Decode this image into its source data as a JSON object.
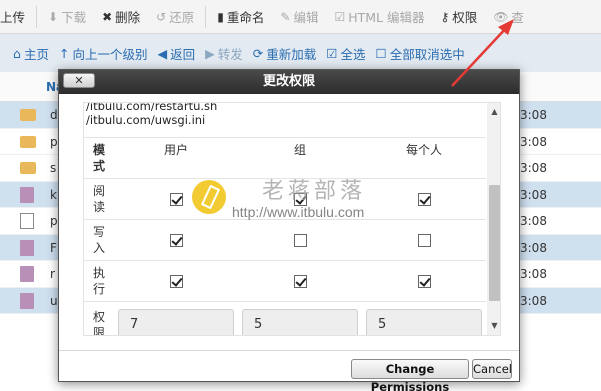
{
  "toolbar": {
    "items": [
      {
        "label": "上传",
        "icon": "upload-icon",
        "disabled": false
      },
      {
        "label": "下载",
        "icon": "download-icon",
        "disabled": true
      },
      {
        "label": "删除",
        "icon": "close-icon",
        "disabled": false
      },
      {
        "label": "还原",
        "icon": "undo-icon",
        "disabled": true
      },
      {
        "label": "重命名",
        "icon": "file-icon",
        "disabled": false
      },
      {
        "label": "编辑",
        "icon": "pencil-icon",
        "disabled": true
      },
      {
        "label": "HTML 编辑器",
        "icon": "html-editor-icon",
        "disabled": true
      },
      {
        "label": "权限",
        "icon": "key-icon",
        "disabled": false
      },
      {
        "label": "查",
        "icon": "eye-icon",
        "disabled": true
      }
    ]
  },
  "navbar": {
    "items": [
      {
        "label": "主页",
        "icon": "home-icon",
        "disabled": false
      },
      {
        "label": "向上一个级别",
        "icon": "level-up-icon",
        "disabled": false
      },
      {
        "label": "返回",
        "icon": "back-arrow-icon",
        "disabled": false
      },
      {
        "label": "转发",
        "icon": "forward-arrow-icon",
        "disabled": true
      },
      {
        "label": "重新加载",
        "icon": "reload-icon",
        "disabled": false
      },
      {
        "label": "全选",
        "icon": "checkbox-checked-icon",
        "disabled": false
      },
      {
        "label": "全部取消选中",
        "icon": "checkbox-empty-icon",
        "disabled": false
      }
    ]
  },
  "filelist": {
    "header": "Na",
    "rows": [
      {
        "type": "folder",
        "name": "d",
        "time": "3:08",
        "selected": true
      },
      {
        "type": "folder",
        "name": "p",
        "time": "3:08",
        "selected": false
      },
      {
        "type": "folder",
        "name": "s",
        "time": "3:08",
        "selected": false
      },
      {
        "type": "file",
        "name": "k",
        "time": "3:08",
        "selected": true
      },
      {
        "type": "zip",
        "name": "p",
        "time": "3:08",
        "selected": false
      },
      {
        "type": "file",
        "name": "F",
        "time": "3:08",
        "selected": true
      },
      {
        "type": "file",
        "name": "r",
        "time": "3:08",
        "selected": false
      },
      {
        "type": "file",
        "name": "u",
        "time": "3:08",
        "selected": true
      }
    ]
  },
  "dialog": {
    "title": "更改权限",
    "close_label": "✕",
    "paths": [
      "/itbulu.com/restartu.sh",
      "/itbulu.com/uwsgi.ini"
    ],
    "mode_label": "模式",
    "columns": [
      "用户",
      "组",
      "每个人"
    ],
    "rows": [
      {
        "label": "阅读",
        "values": [
          true,
          true,
          true
        ]
      },
      {
        "label": "写入",
        "values": [
          true,
          false,
          false
        ]
      },
      {
        "label": "执行",
        "values": [
          true,
          true,
          true
        ]
      }
    ],
    "perm_label": "权限",
    "numeric": [
      "7",
      "5",
      "5"
    ],
    "change_button": "Change Permissions",
    "cancel_button": "Cancel"
  },
  "watermark": {
    "title": "老蒋部落",
    "url": "http://www.itbulu.com"
  },
  "colors": {
    "arrow": "#e53935",
    "link": "#2a6db0",
    "selected_row": "#cfe0ef"
  }
}
